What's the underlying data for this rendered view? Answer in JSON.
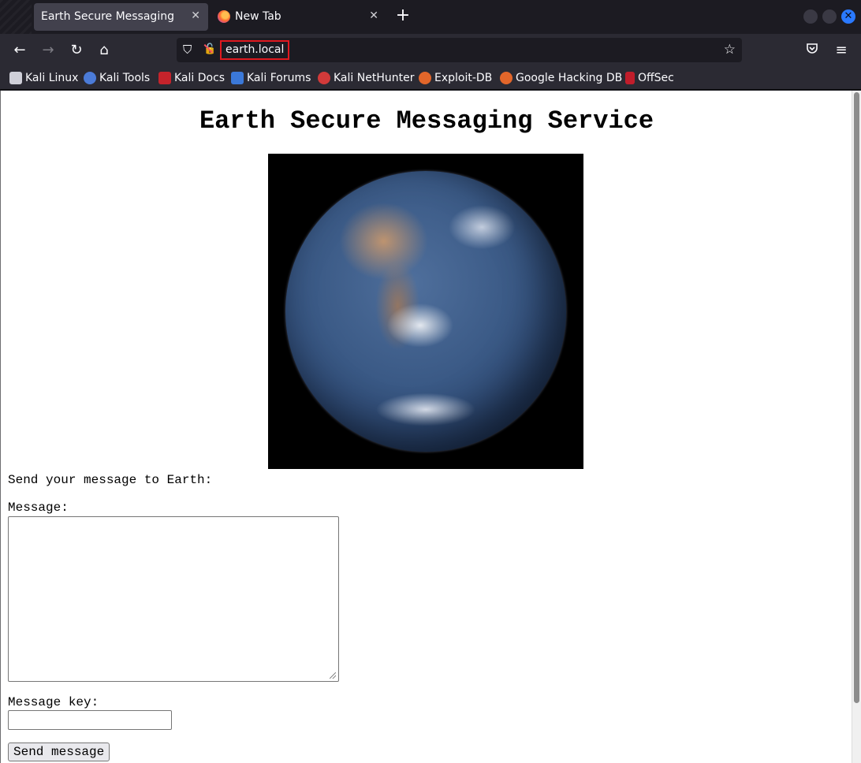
{
  "browser": {
    "tabs": [
      {
        "title": "Earth Secure Messaging",
        "active": true
      },
      {
        "title": "New Tab",
        "active": false
      }
    ],
    "url": "earth.local",
    "bookmarks": [
      {
        "label": "Kali Linux",
        "icon": "kali-dragon-icon"
      },
      {
        "label": "Kali Tools",
        "icon": "kali-tools-icon"
      },
      {
        "label": "Kali Docs",
        "icon": "kali-docs-icon"
      },
      {
        "label": "Kali Forums",
        "icon": "kali-forums-icon"
      },
      {
        "label": "Kali NetHunter",
        "icon": "kali-nethunter-icon"
      },
      {
        "label": "Exploit-DB",
        "icon": "exploit-db-icon"
      },
      {
        "label": "Google Hacking DB",
        "icon": "ghdb-icon"
      },
      {
        "label": "OffSec",
        "icon": "offsec-icon"
      }
    ],
    "colors": {
      "url_highlight": "#e0191f",
      "accent": "#2a79ff"
    }
  },
  "page": {
    "title": "Earth Secure Messaging Service",
    "intro": "Send your message to Earth:",
    "message_label": "Message:",
    "message_value": "",
    "key_label": "Message key:",
    "key_value": "",
    "send_label": "Send message"
  }
}
